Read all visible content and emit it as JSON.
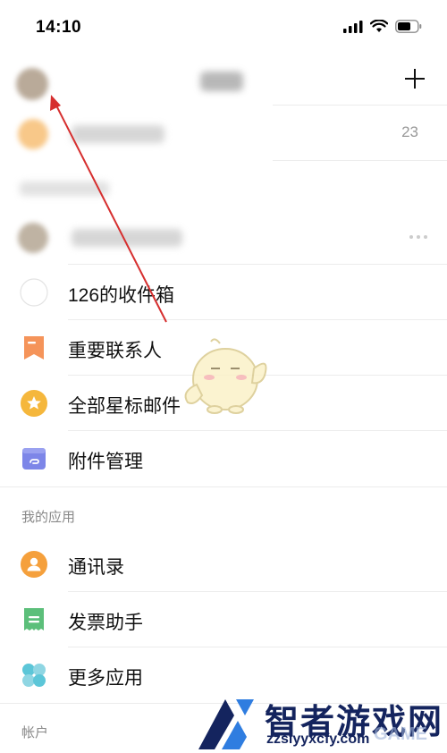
{
  "status_bar": {
    "time": "14:10"
  },
  "header": {
    "plus_icon": "plus-icon"
  },
  "inbox_row": {
    "count": "23",
    "icon_color": "#f8c889"
  },
  "menu_items": [
    {
      "label": "126的收件箱",
      "icon": "circle-outline-icon"
    },
    {
      "label": "重要联系人",
      "icon": "bookmark-icon",
      "color": "#f5945a"
    },
    {
      "label": "全部星标邮件",
      "icon": "star-icon",
      "color": "#f5b73c"
    },
    {
      "label": "附件管理",
      "icon": "attachment-folder-icon",
      "color": "#7d86e8"
    }
  ],
  "apps_section": {
    "title": "我的应用",
    "items": [
      {
        "label": "通讯录",
        "icon": "contacts-icon",
        "color": "#f5a03c"
      },
      {
        "label": "发票助手",
        "icon": "invoice-icon",
        "color": "#5cbf7a"
      },
      {
        "label": "更多应用",
        "icon": "more-apps-icon",
        "color": "#5cc6d8"
      }
    ]
  },
  "account_section": {
    "title": "帐户"
  },
  "watermark": {
    "main": "智者游戏网",
    "sub": "zzslyyxcfy.com",
    "faint": "GAME"
  }
}
